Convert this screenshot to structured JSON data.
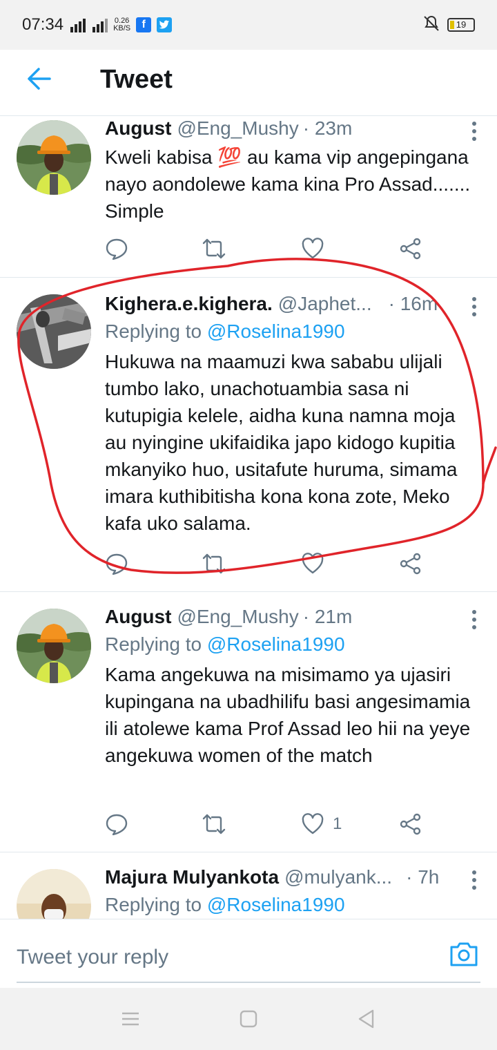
{
  "status_bar": {
    "time": "07:34",
    "net_speed_value": "0.26",
    "net_speed_unit": "KB/S",
    "battery": "19"
  },
  "header": {
    "title": "Tweet"
  },
  "tweets": [
    {
      "name": "August",
      "handle": "@Eng_Mushy",
      "time": "· 23m",
      "replying_prefix": "",
      "replying_to": "",
      "text": "Kweli kabisa 💯 au kama vip angepingana nayo  aondolewe kama kina Pro Assad....... Simple",
      "like_count": ""
    },
    {
      "name": "Kighera.e.kighera.",
      "handle": "@Japhet...",
      "time": "· 16m",
      "replying_prefix": "Replying to",
      "replying_to": "@Roselina1990",
      "text": "Hukuwa na maamuzi kwa sababu ulijali tumbo lako, unachotuambia sasa ni kutupigia kelele, aidha kuna namna moja au nyingine ukifaidika japo kidogo kupitia mkanyiko huo, usitafute huruma, simama imara kuthibitisha kona kona zote, Meko kafa uko salama.",
      "like_count": ""
    },
    {
      "name": "August",
      "handle": "@Eng_Mushy",
      "time": "· 21m",
      "replying_prefix": "Replying to",
      "replying_to": "@Roselina1990",
      "text": "Kama angekuwa na misimamo ya ujasiri kupingana na ubadhilifu basi angesimamia  ili atolewe kama Prof Assad  leo hii na yeye angekuwa women of the match",
      "like_count": "1"
    },
    {
      "name": "Majura Mulyankota",
      "handle": "@mulyank...",
      "time": "· 7h",
      "replying_prefix": "Replying to",
      "replying_to": "@Roselina1990",
      "text": "",
      "like_count": ""
    }
  ],
  "reply_bar": {
    "placeholder": "Tweet your reply"
  },
  "colors": {
    "accent": "#1da1f2",
    "secondary_text": "#657786",
    "annotation": "#e0242a"
  }
}
